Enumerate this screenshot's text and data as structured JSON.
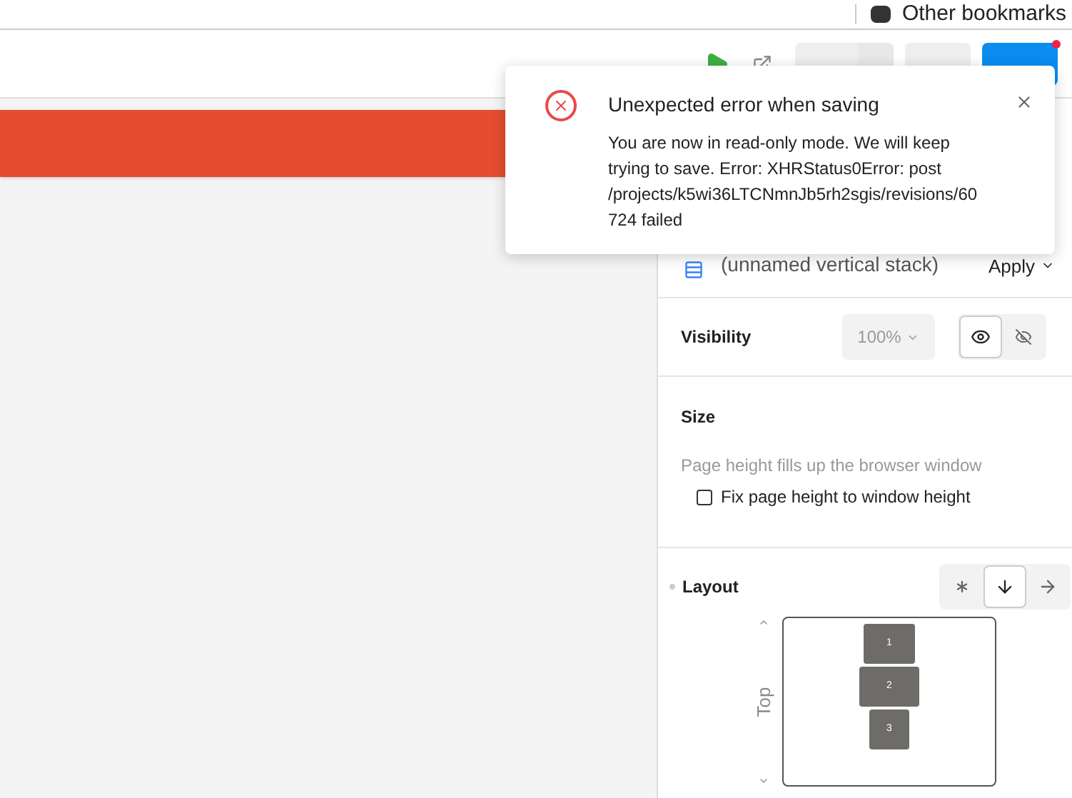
{
  "bookmarks_bar": {
    "folder": "Other bookmarks"
  },
  "toolbar": {
    "publish_notice": true
  },
  "toast": {
    "title": "Unexpected error when saving",
    "message": "You are now in read-only mode. We will keep trying to save. Error: XHRStatus0Error: post /projects/k5wi36LTCNmnJb5rh2sgis/revisions/60724 failed"
  },
  "panel": {
    "element": "(unnamed vertical stack)",
    "apply": "Apply",
    "visibility": {
      "label": "Visibility",
      "opacity": "100%",
      "visible": true
    },
    "size": {
      "label": "Size",
      "hint": "Page height fills up the browser window",
      "fix_label": "Fix page height to window height",
      "fix_checked": false
    },
    "layout": {
      "label": "Layout",
      "modes": [
        {
          "kind": "grid",
          "selected": false
        },
        {
          "kind": "vertical",
          "selected": true
        },
        {
          "kind": "horizontal",
          "selected": false
        }
      ],
      "align": "Top",
      "items": [
        "1",
        "2",
        "3"
      ]
    }
  }
}
